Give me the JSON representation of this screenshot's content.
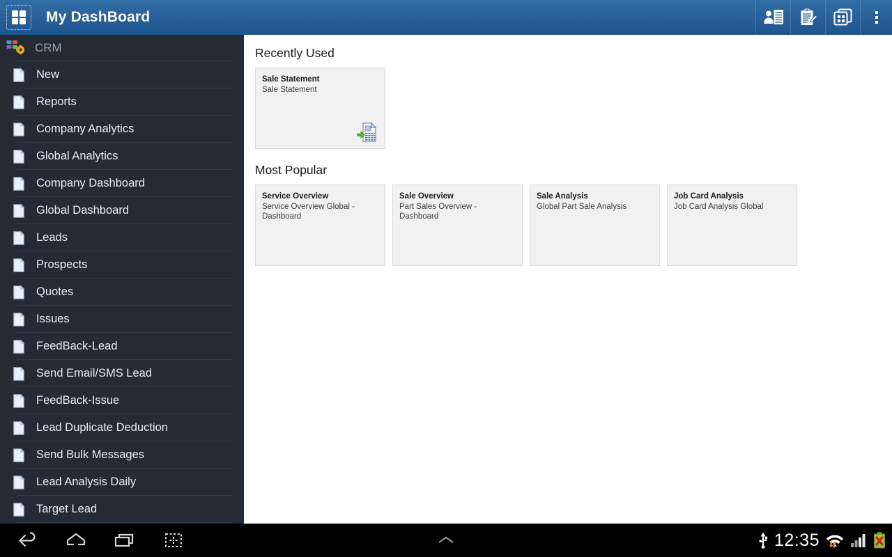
{
  "appbar": {
    "logo_icon": "grid-2x2-icon",
    "title": "My DashBoard",
    "actions": [
      {
        "name": "contact-list-icon",
        "label": "Contacts"
      },
      {
        "name": "clipboard-edit-icon",
        "label": "Tasks"
      },
      {
        "name": "apps-grid-icon",
        "label": "Apps"
      },
      {
        "name": "overflow-menu-icon",
        "label": "More options"
      }
    ]
  },
  "sidebar": {
    "group_icon": "crm-modules-gear-icon",
    "group_label": "CRM",
    "item_icon": "document-page-icon",
    "items": [
      {
        "label": "New"
      },
      {
        "label": "Reports"
      },
      {
        "label": "Company Analytics"
      },
      {
        "label": "Global Analytics"
      },
      {
        "label": "Company Dashboard"
      },
      {
        "label": "Global Dashboard"
      },
      {
        "label": "Leads"
      },
      {
        "label": "Prospects"
      },
      {
        "label": "Quotes"
      },
      {
        "label": "Issues"
      },
      {
        "label": "FeedBack-Lead"
      },
      {
        "label": "Send Email/SMS Lead"
      },
      {
        "label": "FeedBack-Issue"
      },
      {
        "label": "Lead Duplicate Deduction"
      },
      {
        "label": "Send Bulk Messages"
      },
      {
        "label": "Lead Analysis Daily"
      },
      {
        "label": "Target Lead"
      }
    ]
  },
  "content": {
    "recently_used": {
      "title": "Recently Used",
      "cards": [
        {
          "title": "Sale Statement",
          "subtitle": "Sale Statement",
          "icon": "spreadsheet-export-icon"
        }
      ]
    },
    "most_popular": {
      "title": "Most Popular",
      "cards": [
        {
          "title": "Service Overview",
          "subtitle": "Service Overview Global - Dashboard"
        },
        {
          "title": "Sale Overview",
          "subtitle": "Part Sales Overview - Dashboard"
        },
        {
          "title": "Sale Analysis",
          "subtitle": "Global Part Sale Analysis"
        },
        {
          "title": "Job Card Analysis",
          "subtitle": "Job Card Analysis Global"
        }
      ]
    }
  },
  "system_bar": {
    "nav": [
      {
        "name": "back-icon",
        "label": "Back"
      },
      {
        "name": "home-icon",
        "label": "Home"
      },
      {
        "name": "recents-icon",
        "label": "Recent apps"
      },
      {
        "name": "screenshot-icon",
        "label": "Screenshot"
      }
    ],
    "center": {
      "name": "chevron-up-icon",
      "label": "Show navigation"
    },
    "status": {
      "usb_icon": "usb-icon",
      "clock": "12:35",
      "wifi_icon": "wifi-transfer-icon",
      "signal_icon": "cellular-signal-icon",
      "battery_icon": "battery-error-icon"
    }
  },
  "colors": {
    "appbar_top": "#336ea8",
    "appbar_bottom": "#1d5590",
    "sidebar_bg": "#242b35",
    "card_bg": "#f1f1f1",
    "card_border": "#dadada",
    "sidebar_label": "#e8edf2",
    "group_label": "#93a2b0",
    "sysbar_bg": "#000000"
  }
}
